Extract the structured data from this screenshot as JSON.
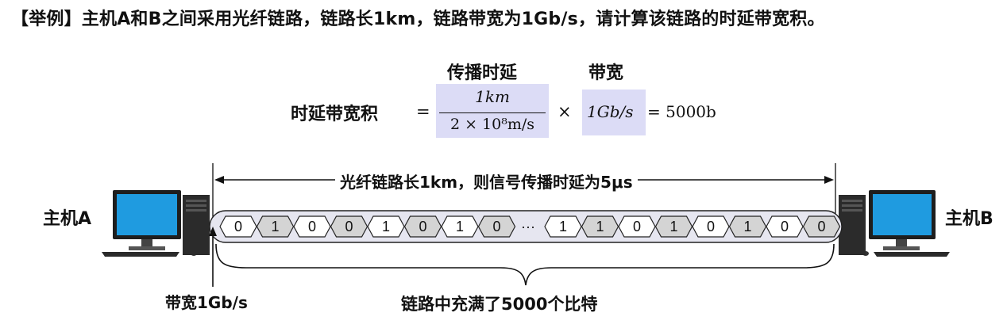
{
  "title": "【举例】主机A和B之间采用光纤链路，链路长1km，链路带宽为1Gb/s，请计算该链路的时延带宽积。",
  "formula": {
    "name": "时延带宽积",
    "delay_header": "传播时延",
    "bandwidth_header": "带宽",
    "equals": "=",
    "numerator": "1km",
    "denominator": "2 × 10⁸m/s",
    "times": "×",
    "bandwidth": "1Gb/s",
    "result": "= 5000b"
  },
  "diagram": {
    "link_length_label": "光纤链路长1km，则信号传播时延为5μs",
    "host_a": "主机A",
    "host_b": "主机B",
    "bandwidth_label": "带宽1Gb/s",
    "filled_label": "链路中充满了5000个比特",
    "bits_left": [
      "0",
      "1",
      "0",
      "0",
      "1",
      "0",
      "1",
      "0"
    ],
    "ellipsis": "···",
    "bits_right": [
      "1",
      "1",
      "0",
      "1",
      "0",
      "1",
      "0",
      "0"
    ]
  },
  "colors": {
    "highlight": "#dcdcf6",
    "bit_white": "#ffffff",
    "bit_gray": "#d4d4d4",
    "link_fill": "#e6e6f0",
    "monitor_screen": "#1f9be0"
  }
}
